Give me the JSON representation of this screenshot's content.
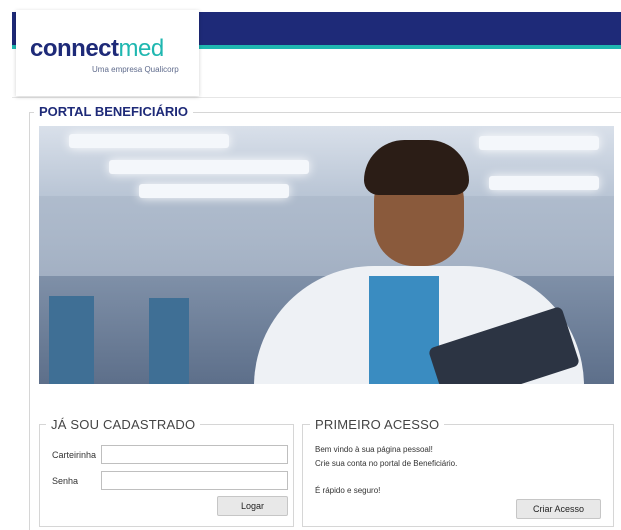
{
  "brand": {
    "name_part1": "connect",
    "name_part2": "med",
    "tagline": "Uma empresa Qualicorp"
  },
  "portal": {
    "title": "PORTAL BENEFICIÁRIO"
  },
  "login": {
    "title": "JÁ SOU CADASTRADO",
    "card_label": "Carteirinha",
    "card_value": "",
    "password_label": "Senha",
    "password_value": "",
    "submit_label": "Logar"
  },
  "first_access": {
    "title": "PRIMEIRO ACESSO",
    "line1": "Bem vindo à sua página pessoal!",
    "line2": "Crie sua conta no portal de Beneficiário.",
    "line3": "É rápido e seguro!",
    "button_label": "Criar Acesso"
  },
  "colors": {
    "navy": "#1e2a78",
    "teal": "#1fb7b0"
  },
  "hero_image": {
    "subject": "doctor-with-tablet-photo"
  }
}
